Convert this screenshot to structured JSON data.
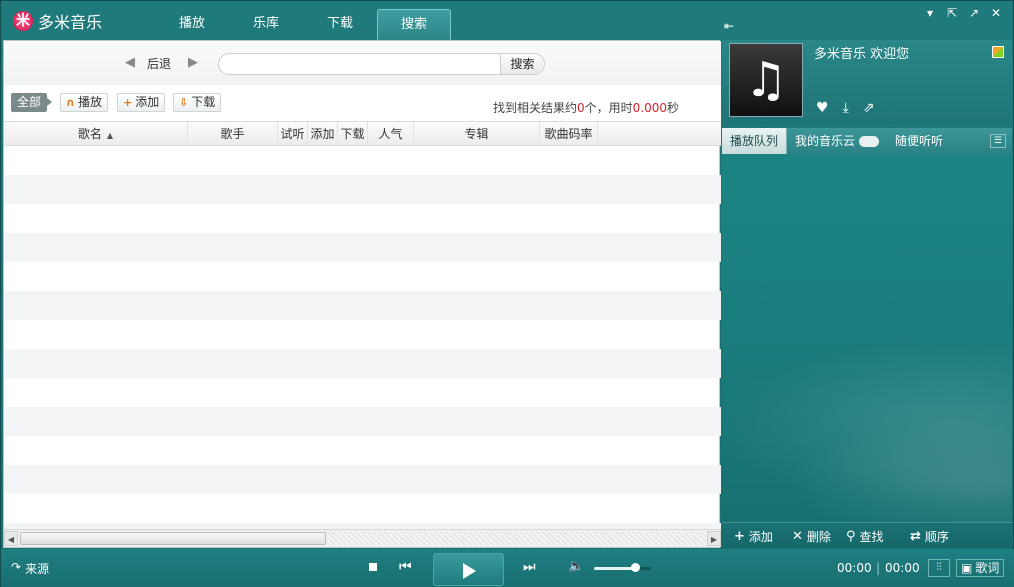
{
  "app": {
    "title": "多米音乐",
    "logo_glyph": "米"
  },
  "nav_tabs": [
    {
      "label": "播放"
    },
    {
      "label": "乐库"
    },
    {
      "label": "下载"
    },
    {
      "label": "搜索"
    }
  ],
  "active_tab": "搜索",
  "window_controls": {
    "dropdown": "▾",
    "mini_mode": "⇱",
    "maximize": "↗",
    "close": "✕"
  },
  "search": {
    "back_label": "后退",
    "query": "",
    "placeholder": "",
    "button_label": "搜索"
  },
  "filter_bar": {
    "all_label": "全部",
    "play_label": "播放",
    "add_label": "添加",
    "download_label": "下载"
  },
  "result_summary": {
    "prefix": "找到相关结果约",
    "count": "0",
    "mid": "个，用时",
    "seconds": "0.000",
    "suffix": "秒"
  },
  "table": {
    "columns": [
      "歌名",
      "歌手",
      "试听",
      "添加",
      "下载",
      "人气",
      "专辑",
      "歌曲码率"
    ],
    "sort_column": "歌名",
    "rows": []
  },
  "now_playing": {
    "welcome": "多米音乐  欢迎您",
    "cover_glyph": "♫"
  },
  "right_tabs": [
    {
      "label": "播放队列"
    },
    {
      "label": "我的音乐云"
    },
    {
      "label": "随便听听"
    }
  ],
  "queue_actions": {
    "add": "添加",
    "delete": "删除",
    "find": "查找",
    "order": "顺序"
  },
  "player": {
    "source_label": "来源",
    "time_elapsed": "00:00",
    "time_total": "00:00",
    "lyrics_label": "歌词",
    "volume": 0.72
  },
  "colors": {
    "accent_teal": "#1f7a7c",
    "highlight_red": "#d4232b",
    "button_orange": "#e07a1f"
  }
}
